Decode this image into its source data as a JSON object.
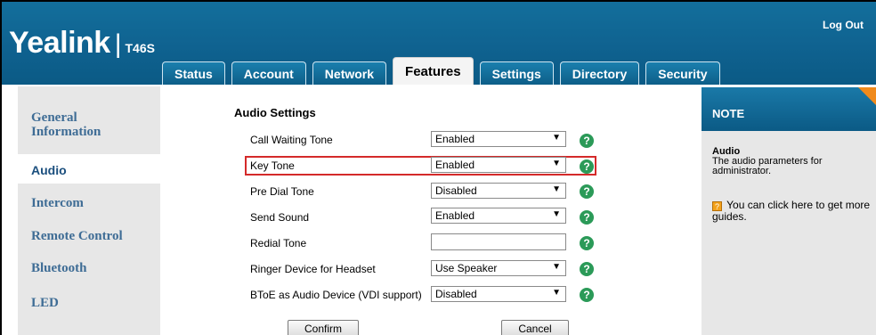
{
  "header": {
    "logo_main": "Yealink",
    "logo_model": "T46S",
    "logout": "Log Out"
  },
  "tabs": [
    {
      "label": "Status",
      "active": false
    },
    {
      "label": "Account",
      "active": false
    },
    {
      "label": "Network",
      "active": false
    },
    {
      "label": "Features",
      "active": true
    },
    {
      "label": "Settings",
      "active": false
    },
    {
      "label": "Directory",
      "active": false
    },
    {
      "label": "Security",
      "active": false
    }
  ],
  "sidebar": {
    "items": [
      {
        "label": "General Information"
      },
      {
        "label": "Audio",
        "active": true
      },
      {
        "label": "Intercom"
      },
      {
        "label": "Remote Control"
      },
      {
        "label": "Bluetooth"
      },
      {
        "label": "LED"
      }
    ]
  },
  "main": {
    "section_title": "Audio Settings",
    "rows": [
      {
        "label": "Call Waiting Tone",
        "value": "Enabled"
      },
      {
        "label": "Key Tone",
        "value": "Enabled"
      },
      {
        "label": "Pre Dial Tone",
        "value": "Disabled"
      },
      {
        "label": "Send Sound",
        "value": "Enabled"
      },
      {
        "label": "Redial Tone",
        "value": ""
      },
      {
        "label": "Ringer Device for Headset",
        "value": "Use Speaker"
      },
      {
        "label": "BToE as Audio Device (VDI support)",
        "value": "Disabled"
      }
    ],
    "confirm_label": "Confirm",
    "cancel_label": "Cancel"
  },
  "note": {
    "title": "NOTE",
    "heading": "Audio",
    "text": "The audio parameters for administrator.",
    "guide_text": "You can click here to get more guides.",
    "guide_icon": "?"
  },
  "icons": {
    "help": "?",
    "dropdown_arrow": "▼"
  },
  "colors": {
    "header_blue": "#0f6290",
    "help_green": "#2b9a58",
    "highlight_red": "#d42a2a",
    "note_corner_orange": "#f08a1c"
  }
}
